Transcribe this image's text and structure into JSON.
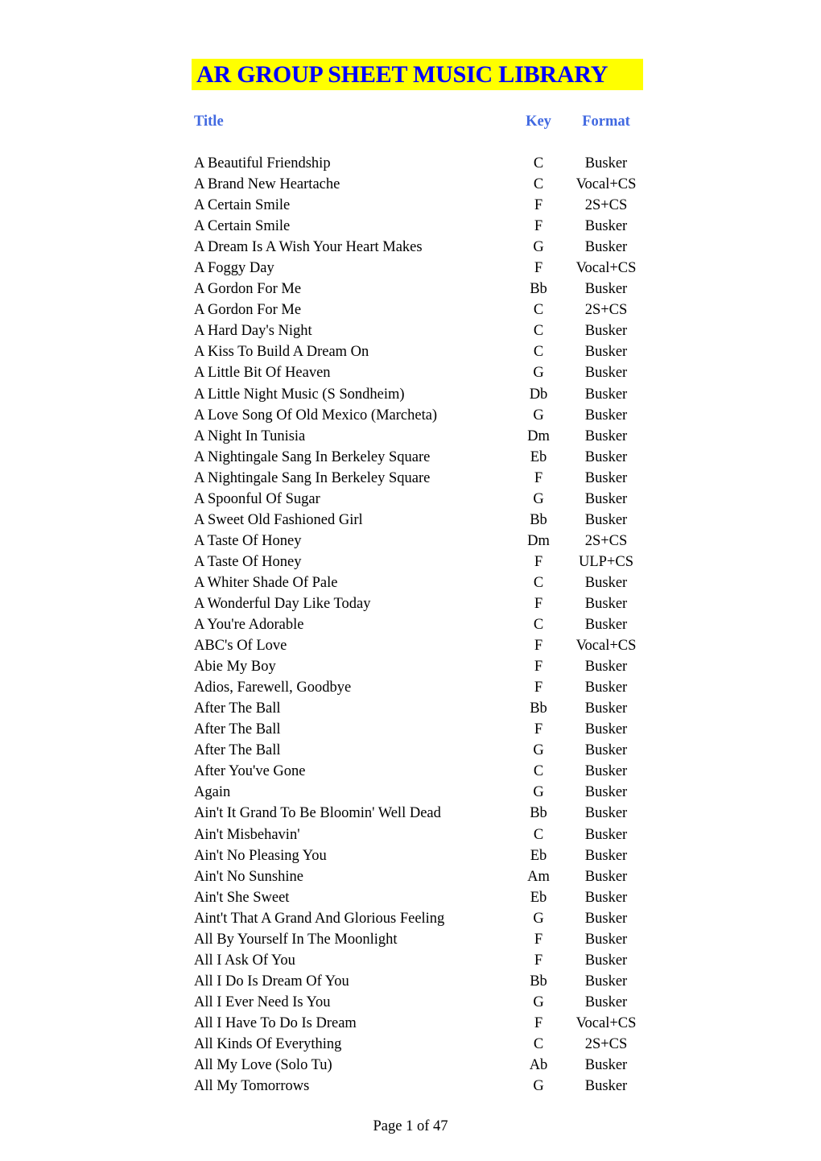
{
  "document": {
    "title": "AR GROUP SHEET MUSIC LIBRARY",
    "colors": {
      "title_text": "#0000FF",
      "title_highlight": "#FFFF00",
      "header_text": "#4169E1",
      "body_text": "#000000"
    }
  },
  "table": {
    "headers": {
      "title": "Title",
      "key": "Key",
      "format": "Format"
    },
    "rows": [
      {
        "title": "A Beautiful Friendship",
        "key": "C",
        "format": "Busker"
      },
      {
        "title": "A Brand New Heartache",
        "key": "C",
        "format": "Vocal+CS"
      },
      {
        "title": "A Certain Smile",
        "key": "F",
        "format": "2S+CS"
      },
      {
        "title": "A Certain Smile",
        "key": "F",
        "format": "Busker"
      },
      {
        "title": "A Dream Is A Wish Your Heart Makes",
        "key": "G",
        "format": "Busker"
      },
      {
        "title": "A Foggy Day",
        "key": "F",
        "format": "Vocal+CS"
      },
      {
        "title": "A Gordon For Me",
        "key": "Bb",
        "format": "Busker"
      },
      {
        "title": "A Gordon For Me",
        "key": "C",
        "format": "2S+CS"
      },
      {
        "title": "A Hard Day's Night",
        "key": "C",
        "format": "Busker"
      },
      {
        "title": "A Kiss To Build A Dream On",
        "key": "C",
        "format": "Busker"
      },
      {
        "title": "A Little Bit Of Heaven",
        "key": "G",
        "format": "Busker"
      },
      {
        "title": "A Little Night Music (S Sondheim)",
        "key": "Db",
        "format": "Busker"
      },
      {
        "title": "A Love Song Of Old Mexico (Marcheta)",
        "key": "G",
        "format": "Busker"
      },
      {
        "title": "A Night In Tunisia",
        "key": "Dm",
        "format": "Busker"
      },
      {
        "title": "A Nightingale Sang In Berkeley Square",
        "key": "Eb",
        "format": "Busker"
      },
      {
        "title": "A Nightingale Sang In Berkeley Square",
        "key": "F",
        "format": "Busker"
      },
      {
        "title": "A Spoonful Of Sugar",
        "key": "G",
        "format": "Busker"
      },
      {
        "title": "A Sweet Old Fashioned Girl",
        "key": "Bb",
        "format": "Busker"
      },
      {
        "title": "A Taste Of Honey",
        "key": "Dm",
        "format": "2S+CS"
      },
      {
        "title": "A Taste Of Honey",
        "key": "F",
        "format": "ULP+CS"
      },
      {
        "title": "A Whiter Shade Of Pale",
        "key": "C",
        "format": "Busker"
      },
      {
        "title": "A Wonderful Day Like Today",
        "key": "F",
        "format": "Busker"
      },
      {
        "title": "A You're Adorable",
        "key": "C",
        "format": "Busker"
      },
      {
        "title": "ABC's Of Love",
        "key": "F",
        "format": "Vocal+CS"
      },
      {
        "title": "Abie My Boy",
        "key": "F",
        "format": "Busker"
      },
      {
        "title": "Adios, Farewell, Goodbye",
        "key": "F",
        "format": "Busker"
      },
      {
        "title": "After The Ball",
        "key": "Bb",
        "format": "Busker"
      },
      {
        "title": "After The Ball",
        "key": "F",
        "format": "Busker"
      },
      {
        "title": "After The Ball",
        "key": "G",
        "format": "Busker"
      },
      {
        "title": "After You've Gone",
        "key": "C",
        "format": "Busker"
      },
      {
        "title": "Again",
        "key": "G",
        "format": "Busker"
      },
      {
        "title": "Ain't It Grand To Be Bloomin' Well Dead",
        "key": "Bb",
        "format": "Busker"
      },
      {
        "title": "Ain't Misbehavin'",
        "key": "C",
        "format": "Busker"
      },
      {
        "title": "Ain't No Pleasing You",
        "key": "Eb",
        "format": "Busker"
      },
      {
        "title": "Ain't No Sunshine",
        "key": "Am",
        "format": "Busker"
      },
      {
        "title": "Ain't She Sweet",
        "key": "Eb",
        "format": "Busker"
      },
      {
        "title": "Aint't That A Grand And Glorious Feeling",
        "key": "G",
        "format": "Busker"
      },
      {
        "title": "All By Yourself In The Moonlight",
        "key": "F",
        "format": "Busker"
      },
      {
        "title": "All I Ask Of You",
        "key": "F",
        "format": "Busker"
      },
      {
        "title": "All I Do Is Dream Of You",
        "key": "Bb",
        "format": "Busker"
      },
      {
        "title": "All I Ever Need Is You",
        "key": "G",
        "format": "Busker"
      },
      {
        "title": "All I Have To Do Is Dream",
        "key": "F",
        "format": "Vocal+CS"
      },
      {
        "title": "All Kinds Of Everything",
        "key": "C",
        "format": "2S+CS"
      },
      {
        "title": "All My Love (Solo Tu)",
        "key": "Ab",
        "format": "Busker"
      },
      {
        "title": "All My Tomorrows",
        "key": "G",
        "format": "Busker"
      }
    ]
  },
  "footer": {
    "page_label": "Page 1 of 47",
    "current_page": 1,
    "total_pages": 47
  }
}
